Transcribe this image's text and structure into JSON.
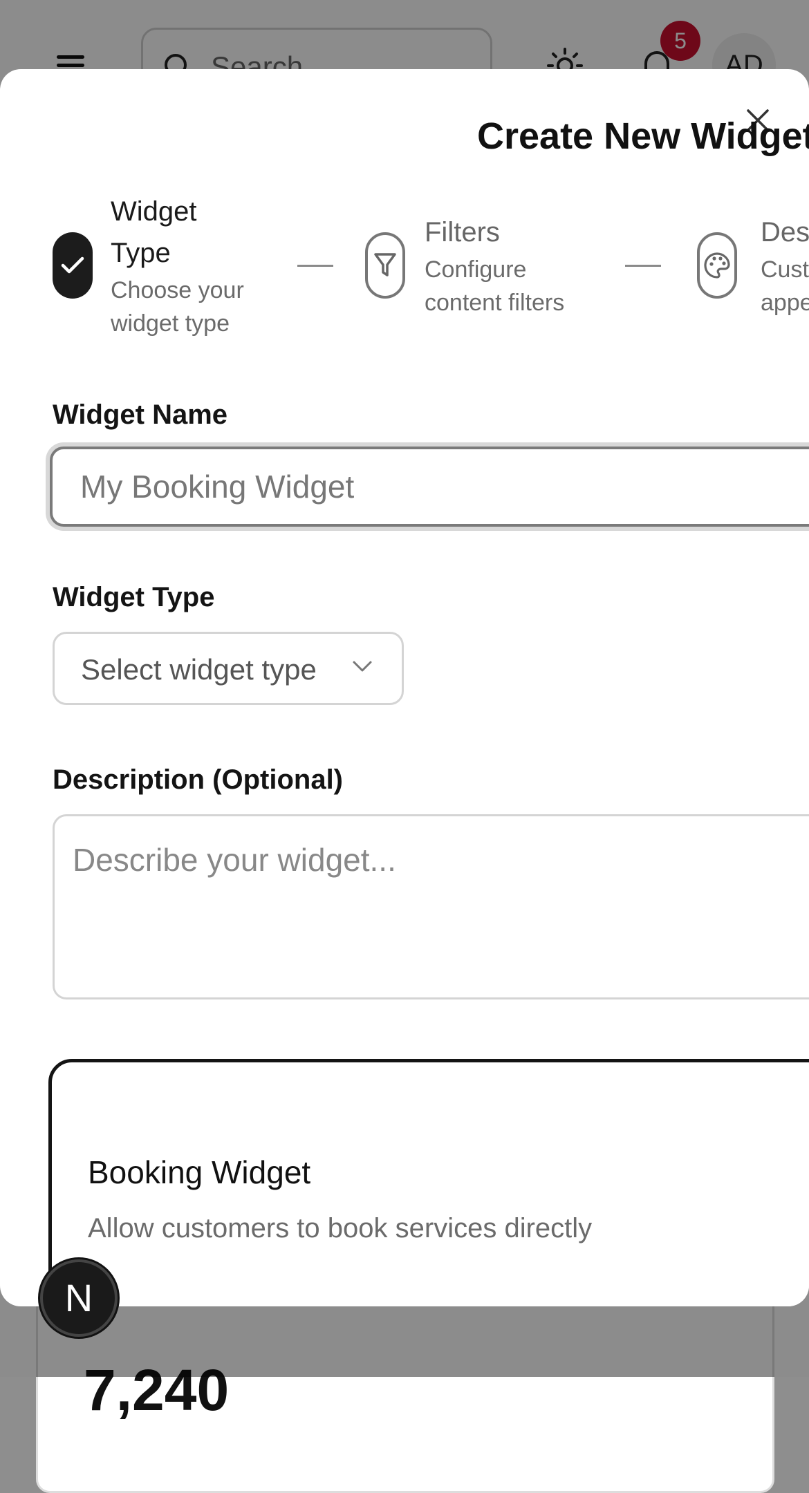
{
  "background": {
    "search": {
      "placeholder": "Search"
    },
    "notifications": {
      "count": "5"
    },
    "avatar": {
      "initials": "AD"
    },
    "card": {
      "value": "7,240"
    }
  },
  "modal": {
    "title": "Create New Widget",
    "steps": [
      {
        "title_line1": "Widget",
        "title_line2": "Type",
        "desc_line1": "Choose your",
        "desc_line2": "widget type",
        "state": "completed",
        "icon": "check-icon"
      },
      {
        "title": "Filters",
        "desc_line1": "Configure",
        "desc_line2": "content filters",
        "state": "pending",
        "icon": "filter-icon"
      },
      {
        "title": "Design",
        "desc_line1": "Customize",
        "desc_line2": "appearance",
        "state": "pending",
        "icon": "palette-icon"
      }
    ],
    "form": {
      "name_label": "Widget Name",
      "name_placeholder": "My Booking Widget",
      "name_value": "",
      "type_label": "Widget Type",
      "type_placeholder": "Select widget type",
      "description_label": "Description (Optional)",
      "description_placeholder": "Describe your widget...",
      "description_value": ""
    },
    "type_options": [
      {
        "title": "Booking Widget",
        "description": "Allow customers to book services directly",
        "selected": true
      }
    ]
  },
  "floating_badge": {
    "letter": "N"
  },
  "colors": {
    "accent": "#1c1c1c",
    "notification_badge": "#c8102e",
    "muted_text": "#6b6b6b"
  }
}
